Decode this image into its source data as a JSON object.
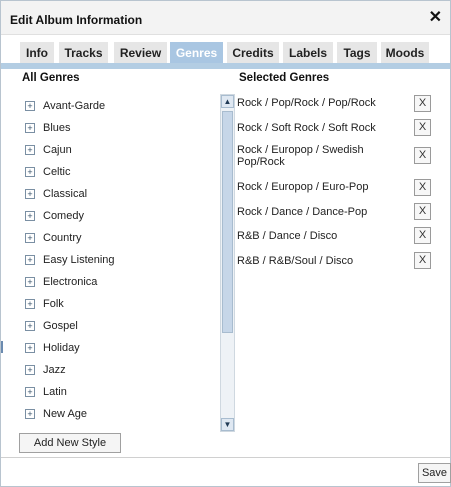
{
  "dialog": {
    "title": "Edit Album Information",
    "close_glyph": "✕"
  },
  "tabs": [
    {
      "label": "Info",
      "active": false
    },
    {
      "label": "Tracks",
      "active": false
    },
    {
      "label": "Review",
      "active": false
    },
    {
      "label": "Genres",
      "active": true
    },
    {
      "label": "Credits",
      "active": false
    },
    {
      "label": "Labels",
      "active": false
    },
    {
      "label": "Tags",
      "active": false
    },
    {
      "label": "Moods",
      "active": false
    }
  ],
  "all_genres": {
    "heading": "All Genres",
    "items": [
      "Avant-Garde",
      "Blues",
      "Cajun",
      "Celtic",
      "Classical",
      "Comedy",
      "Country",
      "Easy Listening",
      "Electronica",
      "Folk",
      "Gospel",
      "Holiday",
      "Jazz",
      "Latin",
      "New Age"
    ]
  },
  "selected_genres": {
    "heading": "Selected Genres",
    "remove_label": "X",
    "items": [
      "Rock / Pop/Rock / Pop/Rock",
      "Rock / Soft Rock / Soft Rock",
      "Rock / Europop / Swedish Pop/Rock",
      "Rock / Europop / Euro-Pop",
      "Rock / Dance / Dance-Pop",
      "R&B / Dance / Disco",
      "R&B / R&B/Soul / Disco"
    ]
  },
  "scrollbar": {
    "up_glyph": "▲",
    "down_glyph": "▼"
  },
  "buttons": {
    "add_new_style": "Add New Style",
    "save": "Save"
  },
  "colors": {
    "active_tab": "#a9c6e2",
    "inactive_tab": "#e6e6e6",
    "tab_bar_border": "#b3cde3"
  }
}
